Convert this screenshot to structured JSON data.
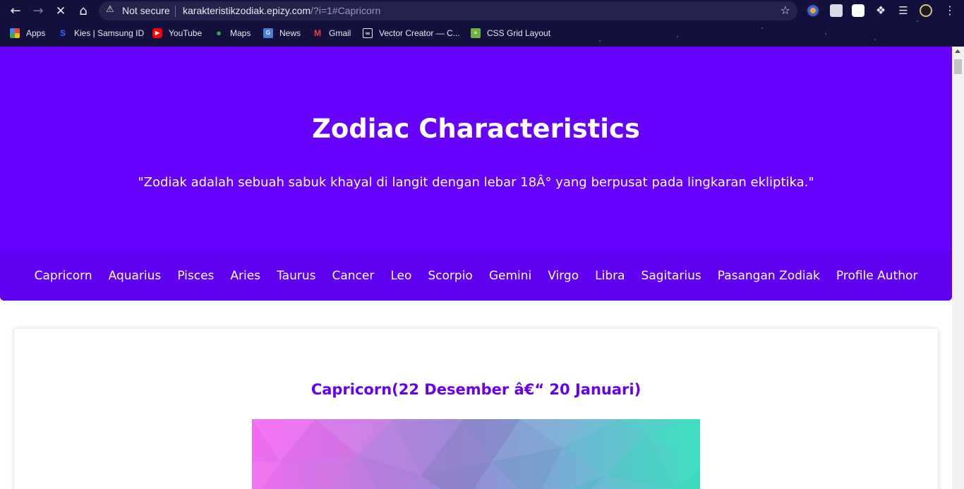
{
  "browser": {
    "security_label": "Not secure",
    "url_host": "karakteristikzodiak.epizy.com",
    "url_path": "/?i=1#Capricorn",
    "bookmarks": [
      {
        "label": "Apps",
        "icon": "apps-grid-icon"
      },
      {
        "label": "Kies | Samsung ID",
        "icon": "samsung-icon"
      },
      {
        "label": "YouTube",
        "icon": "youtube-icon"
      },
      {
        "label": "Maps",
        "icon": "maps-pin-icon"
      },
      {
        "label": "News",
        "icon": "news-icon"
      },
      {
        "label": "Gmail",
        "icon": "gmail-icon"
      },
      {
        "label": "Vector Creator — C...",
        "icon": "vector-creator-icon"
      },
      {
        "label": "CSS Grid Layout",
        "icon": "css-grid-icon"
      }
    ]
  },
  "hero": {
    "title": "Zodiac Characteristics",
    "quote": "\"Zodiak adalah sebuah sabuk khayal di langit dengan lebar 18Â° yang berpusat pada lingkaran ekliptika.\""
  },
  "menu": [
    "Capricorn",
    "Aquarius",
    "Pisces",
    "Aries",
    "Taurus",
    "Cancer",
    "Leo",
    "Scorpio",
    "Gemini",
    "Virgo",
    "Libra",
    "Sagitarius",
    "Pasangan Zodiak",
    "Profile Author"
  ],
  "section": {
    "heading": "Capricorn(22 Desember â€“ 20 Januari)"
  },
  "colors": {
    "hero_bg": "#6600ff",
    "menu_bg": "#5f00f0",
    "heading": "#6600ee",
    "chrome_bg": "#13103d"
  }
}
